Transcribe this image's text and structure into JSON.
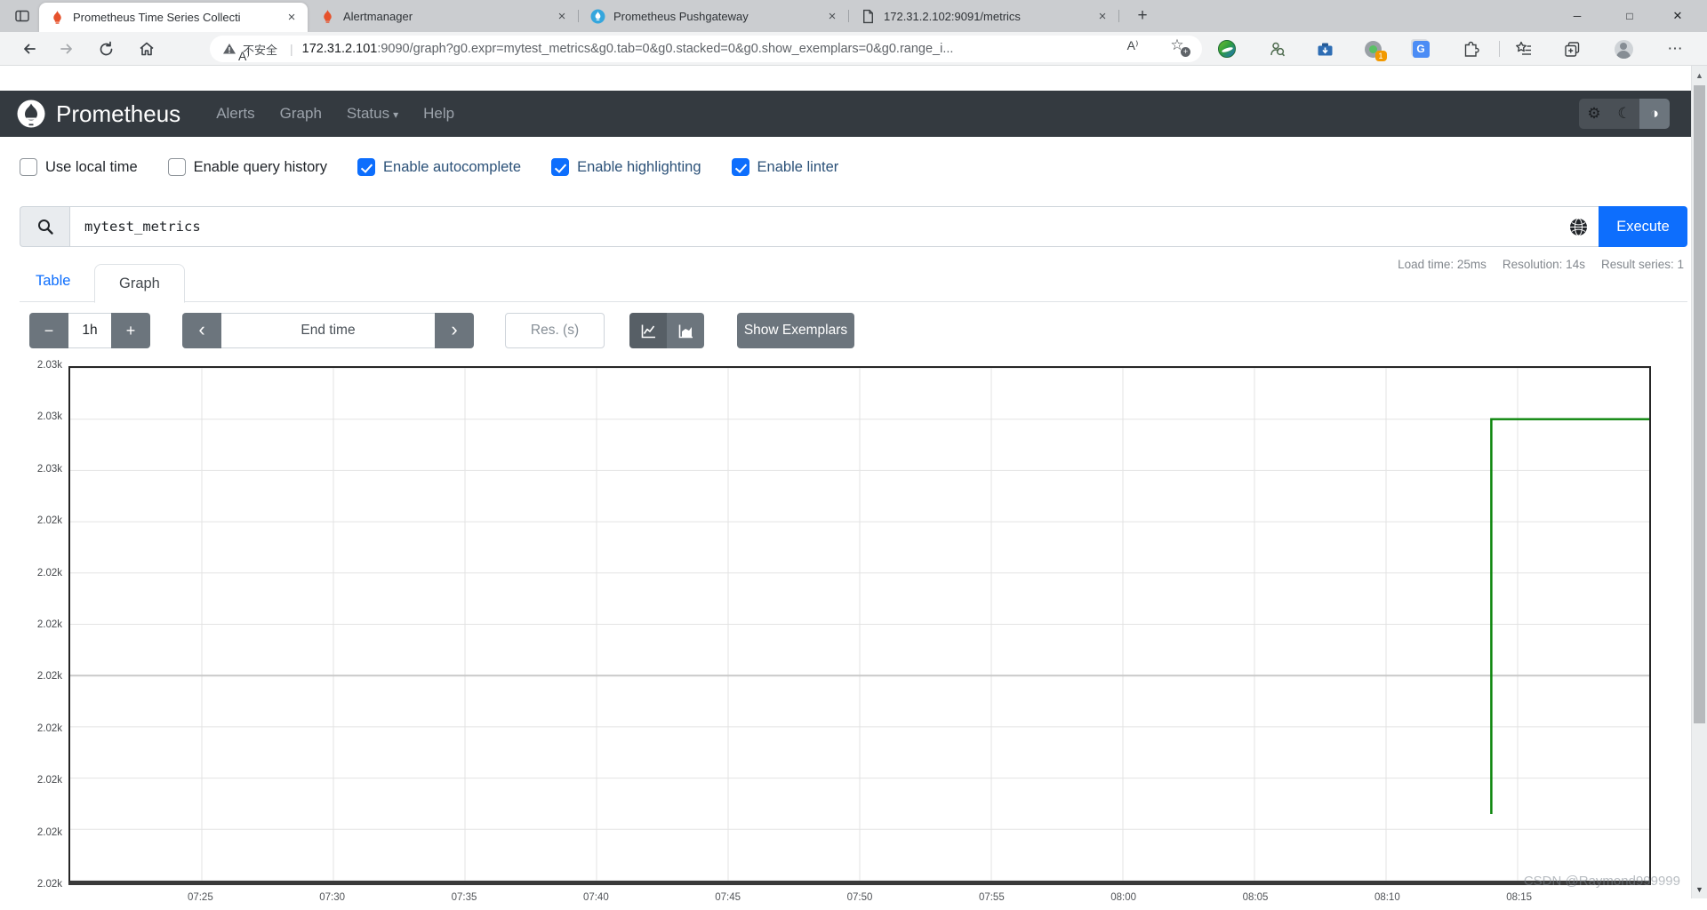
{
  "browser": {
    "tabs": [
      {
        "title": "Prometheus Time Series Collecti",
        "favicon": "prometheus"
      },
      {
        "title": "Alertmanager",
        "favicon": "prometheus"
      },
      {
        "title": "Prometheus Pushgateway",
        "favicon": "pushgateway"
      },
      {
        "title": "172.31.2.102:9091/metrics",
        "favicon": "page"
      }
    ],
    "security_label": "不安全",
    "url_host": "172.31.2.101",
    "url_rest": ":9090/graph?g0.expr=mytest_metrics&g0.tab=0&g0.stacked=0&g0.show_exemplars=0&g0.range_i...",
    "extension_badge": "1"
  },
  "icons": {
    "tab_close": "×",
    "new_tab": "+",
    "minimize": "─",
    "maximize": "□",
    "close": "✕",
    "url_divider": "|",
    "read_aloud": "A⁾",
    "star": "☆",
    "star_add_badge": "+",
    "more": "⋯",
    "translate_letter": "G",
    "gear": "⚙",
    "moon": "☾",
    "contrast": "◑",
    "caret_down": "▾",
    "scroll_up": "▲",
    "scroll_down": "▼"
  },
  "navbar": {
    "brand": "Prometheus",
    "items": [
      {
        "label": "Alerts"
      },
      {
        "label": "Graph"
      },
      {
        "label": "Status",
        "dropdown": true
      },
      {
        "label": "Help"
      }
    ]
  },
  "options": [
    {
      "label": "Use local time",
      "checked": false
    },
    {
      "label": "Enable query history",
      "checked": false
    },
    {
      "label": "Enable autocomplete",
      "checked": true
    },
    {
      "label": "Enable highlighting",
      "checked": true
    },
    {
      "label": "Enable linter",
      "checked": true
    }
  ],
  "query": {
    "value": "mytest_metrics",
    "execute_label": "Execute"
  },
  "result_tabs": {
    "table": "Table",
    "graph": "Graph"
  },
  "stats": {
    "load_time": "Load time: 25ms",
    "resolution": "Resolution: 14s",
    "result_series": "Result series: 1"
  },
  "controls": {
    "zoom_out": "−",
    "range": "1h",
    "zoom_in": "+",
    "prev": "‹",
    "end_time_placeholder": "End time",
    "next": "›",
    "res_placeholder": "Res. (s)",
    "show_exemplars": "Show Exemplars"
  },
  "chart_data": {
    "type": "line",
    "title": "",
    "xlabel": "",
    "ylabel": "",
    "grid": true,
    "legend_position": "none",
    "x_range": [
      "07:20",
      "08:20"
    ],
    "x_ticks": [
      "07:25",
      "07:30",
      "07:35",
      "07:40",
      "07:45",
      "07:50",
      "07:55",
      "08:00",
      "08:05",
      "08:10",
      "08:15"
    ],
    "y_range": [
      2017.3,
      2027.3
    ],
    "y_ticks": [
      {
        "v": 2027.3,
        "label": "2.03k"
      },
      {
        "v": 2026.3,
        "label": "2.03k"
      },
      {
        "v": 2025.3,
        "label": "2.03k"
      },
      {
        "v": 2024.3,
        "label": "2.02k"
      },
      {
        "v": 2023.3,
        "label": "2.02k"
      },
      {
        "v": 2022.3,
        "label": "2.02k"
      },
      {
        "v": 2021.3,
        "label": "2.02k",
        "major": true
      },
      {
        "v": 2020.3,
        "label": "2.02k"
      },
      {
        "v": 2019.3,
        "label": "2.02k"
      },
      {
        "v": 2018.3,
        "label": "2.02k"
      },
      {
        "v": 2017.3,
        "label": "2.02k"
      }
    ],
    "series": [
      {
        "name": "mytest_metrics",
        "color": "#0b850b",
        "step": true,
        "points": [
          {
            "t": "08:14",
            "v": 2018.6
          },
          {
            "t": "08:14",
            "v": 2026.3
          },
          {
            "t": "08:20",
            "v": 2026.3
          }
        ]
      }
    ]
  },
  "watermark": "CSDN @Raymond999999"
}
